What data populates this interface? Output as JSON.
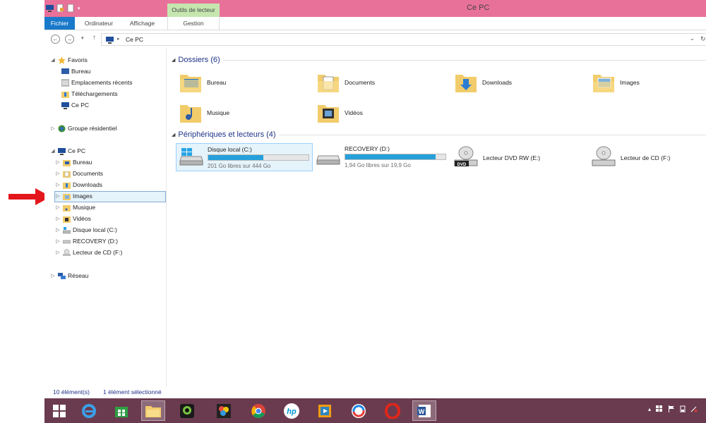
{
  "title_bar": {
    "title": "Ce PC",
    "context_tab": "Outils de lecteur"
  },
  "ribbon": {
    "tabs": [
      {
        "label": "Fichier"
      },
      {
        "label": "Ordinateur"
      },
      {
        "label": "Affichage"
      },
      {
        "label": "Gestion"
      }
    ]
  },
  "address": {
    "path": "Ce PC",
    "back_glyph": "←",
    "forward_glyph": "→",
    "up_glyph": "↑"
  },
  "nav": {
    "favorites": {
      "label": "Favoris",
      "items": [
        "Bureau",
        "Emplacements récents",
        "Téléchargements",
        "Ce PC"
      ]
    },
    "homegroup": "Groupe résidentiel",
    "this_pc": {
      "label": "Ce PC",
      "items": [
        "Bureau",
        "Documents",
        "Downloads",
        "Images",
        "Musique",
        "Vidéos",
        "Disque local (C:)",
        "RECOVERY (D:)",
        "Lecteur de CD (F:)"
      ]
    },
    "network": "Réseau",
    "selected": "Images"
  },
  "folders": {
    "header": "Dossiers (6)",
    "items": [
      "Bureau",
      "Documents",
      "Downloads",
      "Images",
      "Musique",
      "Vidéos"
    ]
  },
  "devices": {
    "header": "Périphériques et lecteurs (4)",
    "drives": [
      {
        "name": "Disque local (C:)",
        "free": "201 Go libres sur 444 Go",
        "used_fraction": 0.547
      },
      {
        "name": "RECOVERY (D:)",
        "free": "1,94 Go libres sur 19,9 Go",
        "used_fraction": 0.902
      }
    ],
    "optical": [
      {
        "name": "Lecteur DVD RW (E:)",
        "badge": "DVD"
      },
      {
        "name": "Lecteur de CD (F:)"
      }
    ]
  },
  "status": {
    "count": "10 élément(s)",
    "selection": "1 élément sélectionné"
  },
  "taskbar": {
    "apps": [
      "start-icon",
      "ie-icon",
      "store-icon",
      "file-explorer-icon",
      "webcam-icon",
      "paint-icon",
      "chrome-icon",
      "hp-icon",
      "media-player-icon",
      "app-swirl-icon",
      "opera-icon",
      "word-icon"
    ],
    "word_badge": "W",
    "hp_badge": "hp"
  },
  "colors": {
    "title_bar": "#e8719a",
    "file_tab": "#1979ca",
    "context_tab": "#c6e6b0",
    "taskbar": "#6a3b4e",
    "progress": "#26a0da",
    "selection": "#e5f3fb",
    "arrow": "#e3161b"
  }
}
